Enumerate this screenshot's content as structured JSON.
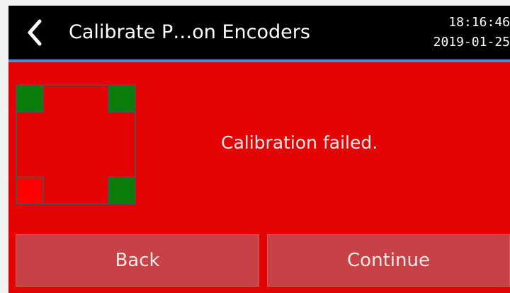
{
  "header": {
    "title": "Calibrate P…on Encoders",
    "time": "18:16:46",
    "date": "2019-01-25",
    "back_icon": "chevron-left-icon"
  },
  "encoders": {
    "status_colors": {
      "ok": "#0a7d0a",
      "failed": "#ff0000"
    },
    "corners": [
      {
        "position": "top-left",
        "status": "ok"
      },
      {
        "position": "top-right",
        "status": "ok"
      },
      {
        "position": "bottom-left",
        "status": "failed"
      },
      {
        "position": "bottom-right",
        "status": "ok"
      }
    ]
  },
  "main": {
    "message": "Calibration failed."
  },
  "buttons": {
    "back_label": "Back",
    "continue_label": "Continue"
  },
  "theme": {
    "background": "#e40303",
    "header_background": "#000000",
    "accent": "#4a8fd2",
    "button_background": "#c74247"
  }
}
